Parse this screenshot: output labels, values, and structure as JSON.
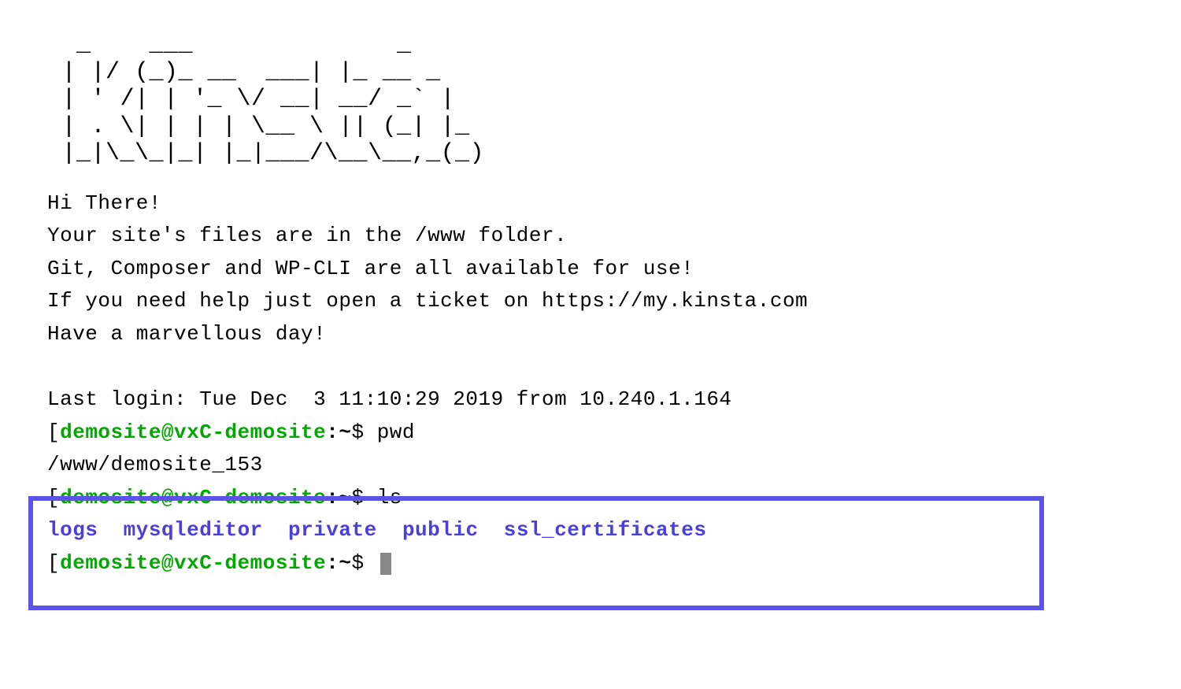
{
  "ascii_art": "  _    ___              _\n | |/ (_)_ __  ___| |_ __ _\n | ' /| | '_ \\/ __| __/ _` |\n | . \\| | | | \\__ \\ || (_| |_\n |_|\\_\\_|_| |_|___/\\__\\__,_(_)",
  "motd": {
    "line1": "Hi There!",
    "line2": "Your site's files are in the /www folder.",
    "line3": "Git, Composer and WP-CLI are all available for use!",
    "line4": "If you need help just open a ticket on https://my.kinsta.com",
    "line5": "Have a marvellous day!"
  },
  "last_login": "Last login: Tue Dec  3 11:10:29 2019 from 10.240.1.164",
  "prompt": {
    "bracket": "[",
    "user_host": "demosite@vxC-demosite",
    "colon": ":",
    "path": "~",
    "dollar": "$ "
  },
  "commands": {
    "pwd": {
      "cmd": "pwd",
      "output": "/www/demosite_153"
    },
    "ls": {
      "cmd": "ls",
      "output": {
        "d1": "logs",
        "s1": "  ",
        "d2": "mysqleditor",
        "s2": "  ",
        "d3": "private",
        "s3": "  ",
        "d4": "public",
        "s4": "  ",
        "d5": "ssl_certificates"
      }
    }
  }
}
